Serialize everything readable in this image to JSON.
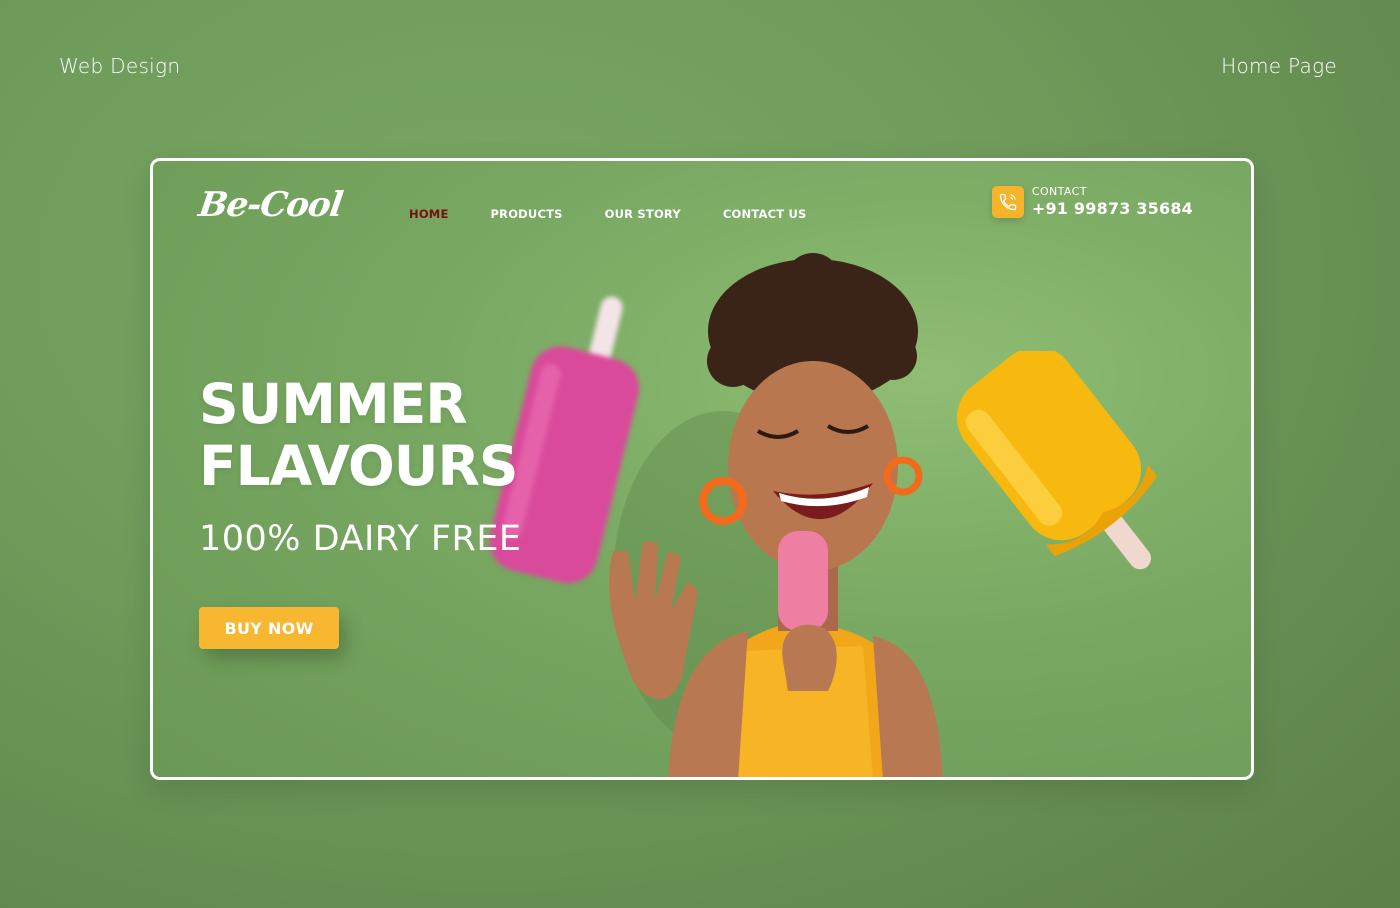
{
  "presentation": {
    "left_label": "Web Design",
    "right_label": "Home Page"
  },
  "site": {
    "logo": "Be-Cool",
    "nav": {
      "items": [
        {
          "label": "HOME",
          "active": true
        },
        {
          "label": "PRODUCTS",
          "active": false
        },
        {
          "label": "OUR STORY",
          "active": false
        },
        {
          "label": "CONTACT US",
          "active": false
        }
      ]
    },
    "contact": {
      "label": "CONTACT",
      "phone": "+91 99873 35684",
      "icon": "phone-icon"
    },
    "hero": {
      "headline_line1": "SUMMER",
      "headline_line2": "FLAVOURS",
      "subhead": "100% DAIRY FREE",
      "cta_label": "BUY NOW"
    }
  },
  "colors": {
    "background": "#6e9a5a",
    "frame_background": "#78a862",
    "accent_yellow": "#f8b731",
    "active_nav": "#7a0f12",
    "text": "#ffffff"
  }
}
